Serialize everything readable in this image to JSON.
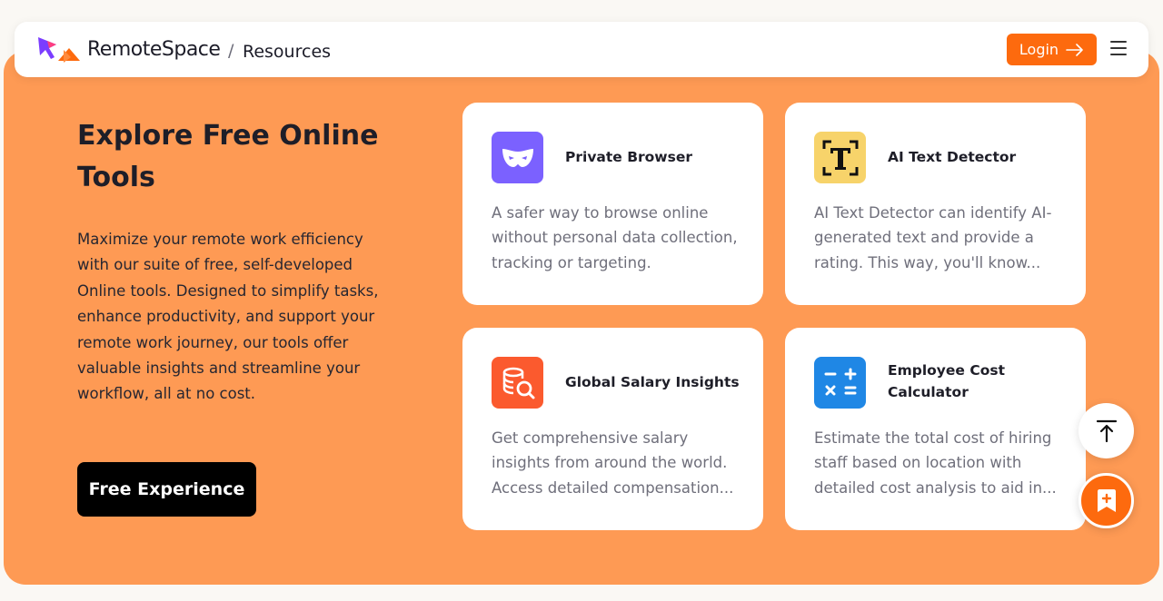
{
  "header": {
    "brand": "RemoteSpace",
    "separator": "/",
    "breadcrumb": "Resources",
    "login_label": "Login",
    "logo_icon": "remotespace-logo",
    "arrow_icon": "arrow-right-icon",
    "menu_icon": "hamburger-menu-icon"
  },
  "hero": {
    "title": "Explore Free Online Tools",
    "description": "Maximize your remote work efficiency with our suite of free, self-developed Online tools. Designed to simplify tasks, enhance productivity, and support your remote work journey, our tools offer valuable insights and streamline your workflow, all at no cost.",
    "cta_label": "Free Experience",
    "background_color": "#fe9a54"
  },
  "tools": [
    {
      "title": "Private Browser",
      "description": "A safer way to browse online without personal data collection, tracking or targeting.",
      "icon": "mask-icon",
      "icon_color": "#7b61ff"
    },
    {
      "title": "AI Text Detector",
      "description": "AI Text Detector can identify AI-generated text and provide a rating. This way, you'll know...",
      "icon": "text-detect-icon",
      "icon_color": "#f7d36a"
    },
    {
      "title": "Global Salary Insights",
      "description": "Get comprehensive salary insights from around the world. Access detailed compensation...",
      "icon": "salary-search-icon",
      "icon_color": "#fb5a2e"
    },
    {
      "title": "Employee Cost Calculator",
      "description": "Estimate the total cost of hiring staff based on location with detailed cost analysis to aid in...",
      "icon": "calculator-icon",
      "icon_color": "#1f87e5"
    }
  ],
  "floating": {
    "scroll_top_icon": "scroll-to-top-icon",
    "feedback_icon": "add-note-icon"
  },
  "colors": {
    "accent": "#fd6a0e",
    "text_dark": "#1e1e28",
    "text_muted": "#6f6f7b"
  }
}
